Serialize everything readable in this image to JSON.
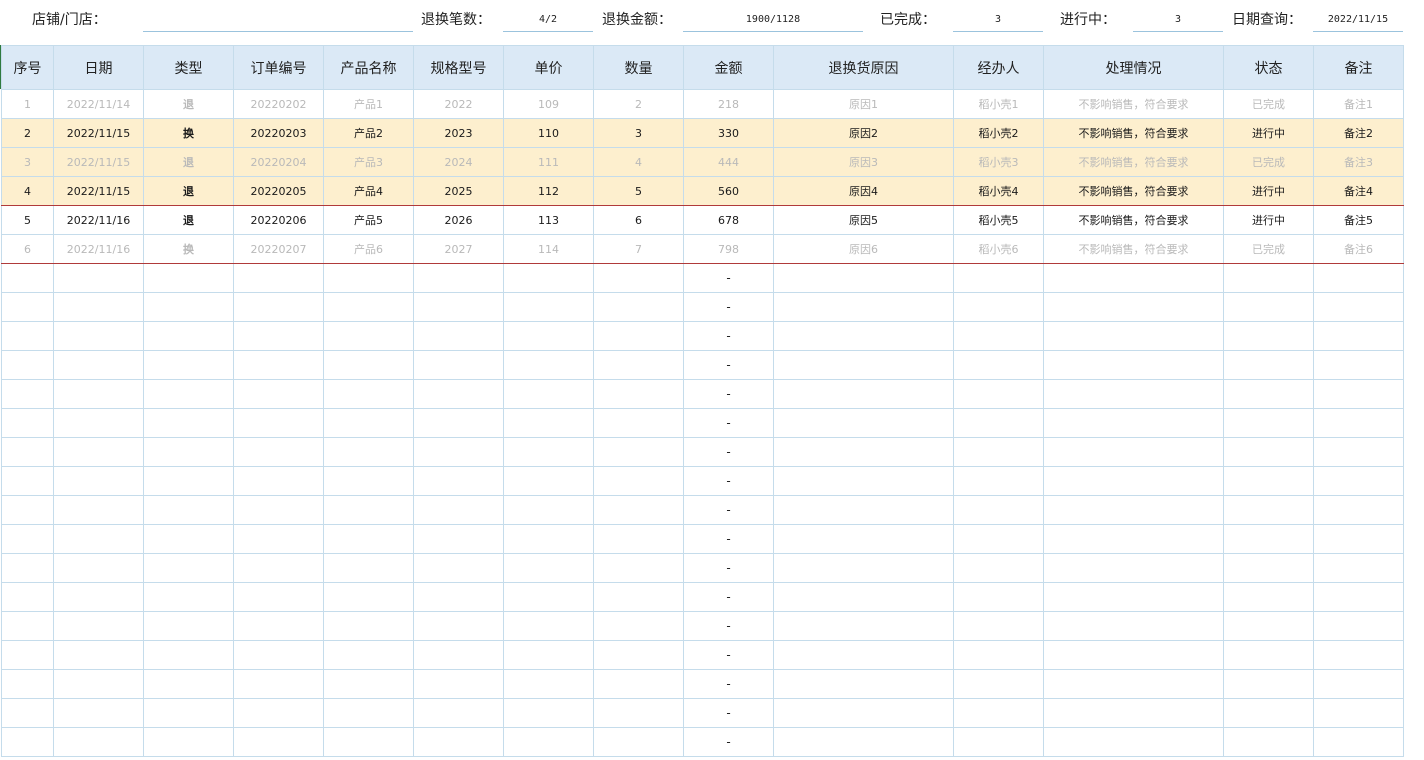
{
  "summary": {
    "store_label": "店铺/门店：",
    "store_value": "",
    "count_label": "退换笔数：",
    "count_value": "4/2",
    "amount_label": "退换金额：",
    "amount_value": "1900/1128",
    "done_label": "已完成：",
    "done_value": "3",
    "progress_label": "进行中：",
    "progress_value": "3",
    "date_label": "日期查询：",
    "date_value": "2022/11/15"
  },
  "columns": [
    "序号",
    "日期",
    "类型",
    "订单编号",
    "产品名称",
    "规格型号",
    "单价",
    "数量",
    "金额",
    "退换货原因",
    "经办人",
    "处理情况",
    "状态",
    "备注"
  ],
  "rows": [
    {
      "seq": "1",
      "date": "2022/11/14",
      "type": "退",
      "order": "20220202",
      "product": "产品1",
      "spec": "2022",
      "price": "109",
      "qty": "2",
      "amount": "218",
      "reason": "原因1",
      "handler": "稻小壳1",
      "process": "不影响销售，符合要求",
      "status": "已完成",
      "note": "备注1",
      "style": "done"
    },
    {
      "seq": "2",
      "date": "2022/11/15",
      "type": "换",
      "order": "20220203",
      "product": "产品2",
      "spec": "2023",
      "price": "110",
      "qty": "3",
      "amount": "330",
      "reason": "原因2",
      "handler": "稻小壳2",
      "process": "不影响销售，符合要求",
      "status": "进行中",
      "note": "备注2",
      "style": "hl"
    },
    {
      "seq": "3",
      "date": "2022/11/15",
      "type": "退",
      "order": "20220204",
      "product": "产品3",
      "spec": "2024",
      "price": "111",
      "qty": "4",
      "amount": "444",
      "reason": "原因3",
      "handler": "稻小壳3",
      "process": "不影响销售，符合要求",
      "status": "已完成",
      "note": "备注3",
      "style": "hl-done"
    },
    {
      "seq": "4",
      "date": "2022/11/15",
      "type": "退",
      "order": "20220205",
      "product": "产品4",
      "spec": "2025",
      "price": "112",
      "qty": "5",
      "amount": "560",
      "reason": "原因4",
      "handler": "稻小壳4",
      "process": "不影响销售，符合要求",
      "status": "进行中",
      "note": "备注4",
      "style": "hl"
    },
    {
      "seq": "5",
      "date": "2022/11/16",
      "type": "退",
      "order": "20220206",
      "product": "产品5",
      "spec": "2026",
      "price": "113",
      "qty": "6",
      "amount": "678",
      "reason": "原因5",
      "handler": "稻小壳5",
      "process": "不影响销售，符合要求",
      "status": "进行中",
      "note": "备注5",
      "style": "normal"
    },
    {
      "seq": "6",
      "date": "2022/11/16",
      "type": "换",
      "order": "20220207",
      "product": "产品6",
      "spec": "2027",
      "price": "114",
      "qty": "7",
      "amount": "798",
      "reason": "原因6",
      "handler": "稻小壳6",
      "process": "不影响销售，符合要求",
      "status": "已完成",
      "note": "备注6",
      "style": "done"
    }
  ],
  "empty_amount_placeholder": "-",
  "empty_row_count": 17,
  "colors": {
    "header_bg": "#dbe9f6",
    "highlight_bg": "#fdefce",
    "grid_line": "#c5dceb",
    "completed_text": "#b9b9b9",
    "red_border": "#b03a3a"
  }
}
